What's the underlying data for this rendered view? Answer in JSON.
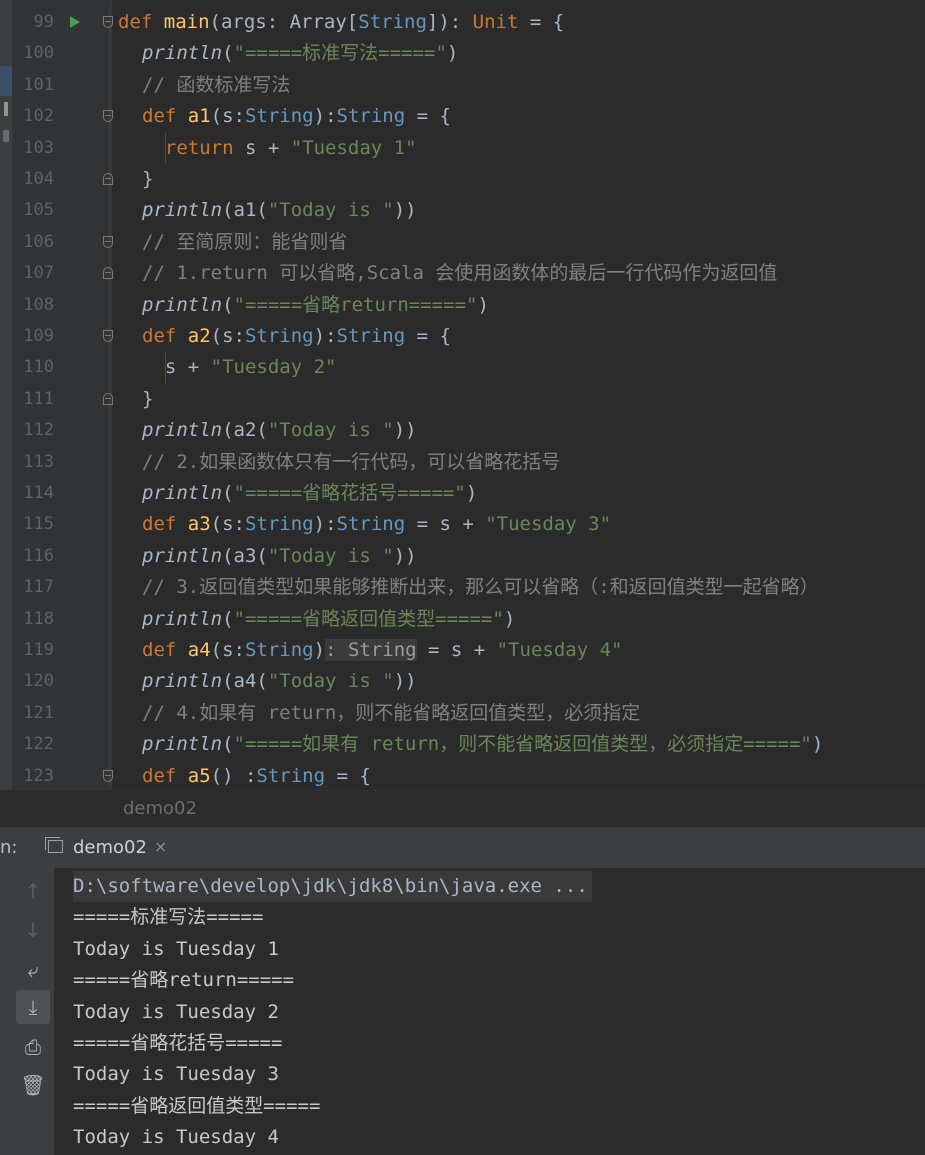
{
  "editor": {
    "lines": [
      {
        "no": "99",
        "tokens": [
          [
            "k",
            "def "
          ],
          [
            "f",
            "main"
          ],
          [
            "tp",
            "(args: Array["
          ],
          [
            "ty",
            "String"
          ],
          [
            "tp",
            "]): "
          ],
          [
            "k",
            "Unit"
          ],
          [
            "tp",
            " = {"
          ]
        ]
      },
      {
        "no": "100",
        "tokens": [
          [
            "p",
            "println"
          ],
          [
            "tp",
            "("
          ],
          [
            "t",
            "\"=====标准写法=====\""
          ],
          [
            "tp",
            ")"
          ]
        ]
      },
      {
        "no": "101",
        "tokens": [
          [
            "c",
            "// 函数标准写法"
          ]
        ]
      },
      {
        "no": "102",
        "tokens": [
          [
            "k",
            "def "
          ],
          [
            "f",
            "a1"
          ],
          [
            "tp",
            "(s:"
          ],
          [
            "ty",
            "String"
          ],
          [
            "tp",
            "):"
          ],
          [
            "ty",
            "String"
          ],
          [
            "tp",
            " = {"
          ]
        ]
      },
      {
        "no": "103",
        "tokens": [
          [
            "tp",
            "  "
          ],
          [
            "k",
            "return "
          ],
          [
            "tp",
            "s + "
          ],
          [
            "t",
            "\"Tuesday 1\""
          ]
        ]
      },
      {
        "no": "104",
        "tokens": [
          [
            "tp",
            "}"
          ]
        ]
      },
      {
        "no": "105",
        "tokens": [
          [
            "p",
            "println"
          ],
          [
            "tp",
            "(a1("
          ],
          [
            "t",
            "\"Today is \""
          ],
          [
            "tp",
            "))"
          ]
        ]
      },
      {
        "no": "106",
        "tokens": [
          [
            "c",
            "// 至简原则：能省则省"
          ]
        ]
      },
      {
        "no": "107",
        "tokens": [
          [
            "c",
            "// 1.return 可以省略,Scala 会使用函数体的最后一行代码作为返回值"
          ]
        ]
      },
      {
        "no": "108",
        "tokens": [
          [
            "p",
            "println"
          ],
          [
            "tp",
            "("
          ],
          [
            "t",
            "\"=====省略return=====\""
          ],
          [
            "tp",
            ")"
          ]
        ]
      },
      {
        "no": "109",
        "tokens": [
          [
            "k",
            "def "
          ],
          [
            "f",
            "a2"
          ],
          [
            "tp",
            "(s:"
          ],
          [
            "ty",
            "String"
          ],
          [
            "tp",
            "):"
          ],
          [
            "ty",
            "String"
          ],
          [
            "tp",
            " = {"
          ]
        ]
      },
      {
        "no": "110",
        "tokens": [
          [
            "tp",
            "  s + "
          ],
          [
            "t",
            "\"Tuesday 2\""
          ]
        ]
      },
      {
        "no": "111",
        "tokens": [
          [
            "tp",
            "}"
          ]
        ]
      },
      {
        "no": "112",
        "tokens": [
          [
            "p",
            "println"
          ],
          [
            "tp",
            "(a2("
          ],
          [
            "t",
            "\"Today is \""
          ],
          [
            "tp",
            "))"
          ]
        ]
      },
      {
        "no": "113",
        "tokens": [
          [
            "c",
            "// 2.如果函数体只有一行代码，可以省略花括号"
          ]
        ]
      },
      {
        "no": "114",
        "tokens": [
          [
            "p",
            "println"
          ],
          [
            "tp",
            "("
          ],
          [
            "t",
            "\"=====省略花括号=====\""
          ],
          [
            "tp",
            ")"
          ]
        ]
      },
      {
        "no": "115",
        "tokens": [
          [
            "k",
            "def "
          ],
          [
            "f",
            "a3"
          ],
          [
            "tp",
            "(s:"
          ],
          [
            "ty",
            "String"
          ],
          [
            "tp",
            "):"
          ],
          [
            "ty",
            "String"
          ],
          [
            "tp",
            " = s + "
          ],
          [
            "t",
            "\"Tuesday 3\""
          ]
        ]
      },
      {
        "no": "116",
        "tokens": [
          [
            "p",
            "println"
          ],
          [
            "tp",
            "(a3("
          ],
          [
            "t",
            "\"Today is \""
          ],
          [
            "tp",
            "))"
          ]
        ]
      },
      {
        "no": "117",
        "tokens": [
          [
            "c",
            "// 3.返回值类型如果能够推断出来，那么可以省略（:和返回值类型一起省略）"
          ]
        ]
      },
      {
        "no": "118",
        "tokens": [
          [
            "p",
            "println"
          ],
          [
            "tp",
            "("
          ],
          [
            "t",
            "\"=====省略返回值类型=====\""
          ],
          [
            "tp",
            ")"
          ]
        ]
      },
      {
        "no": "119",
        "tokens": [
          [
            "k",
            "def "
          ],
          [
            "f",
            "a4"
          ],
          [
            "tp",
            "(s:"
          ],
          [
            "ty",
            "String"
          ],
          [
            "tp",
            ")"
          ],
          [
            "hint",
            ": String"
          ],
          [
            "tp",
            " = s + "
          ],
          [
            "t",
            "\"Tuesday 4\""
          ]
        ]
      },
      {
        "no": "120",
        "tokens": [
          [
            "p",
            "println"
          ],
          [
            "tp",
            "(a4("
          ],
          [
            "t",
            "\"Today is \""
          ],
          [
            "tp",
            "))"
          ]
        ]
      },
      {
        "no": "121",
        "tokens": [
          [
            "c",
            "// 4.如果有 return，则不能省略返回值类型，必须指定"
          ]
        ]
      },
      {
        "no": "122",
        "tokens": [
          [
            "p",
            "println"
          ],
          [
            "tp",
            "("
          ],
          [
            "t",
            "\"=====如果有 return，则不能省略返回值类型，必须指定=====\""
          ],
          [
            "tp",
            ")"
          ]
        ]
      },
      {
        "no": "123",
        "tokens": [
          [
            "k",
            "def "
          ],
          [
            "f",
            "a5"
          ],
          [
            "tp",
            "() :"
          ],
          [
            "ty",
            "String"
          ],
          [
            "tp",
            " = {"
          ]
        ]
      }
    ],
    "footer_breadcrumb": "demo02"
  },
  "run_panel": {
    "label": "n:",
    "tab_label": "demo02",
    "tab_close": "×",
    "tools": [
      "up-arrow-icon",
      "down-arrow-icon",
      "soft-wrap-icon",
      "scroll-to-end-icon",
      "print-icon",
      "trash-icon"
    ],
    "output": [
      "D:\\software\\develop\\jdk\\jdk8\\bin\\java.exe ...",
      "=====标准写法=====",
      "Today is Tuesday 1",
      "=====省略return=====",
      "Today is Tuesday 2",
      "=====省略花括号=====",
      "Today is Tuesday 3",
      "=====省略返回值类型=====",
      "Today is Tuesday 4"
    ]
  },
  "colors": {
    "background": "#2b2b2b",
    "keyword": "#cc7832",
    "function": "#ffc66d",
    "string": "#6a8759",
    "comment": "#808080",
    "type": "#6897bb"
  }
}
